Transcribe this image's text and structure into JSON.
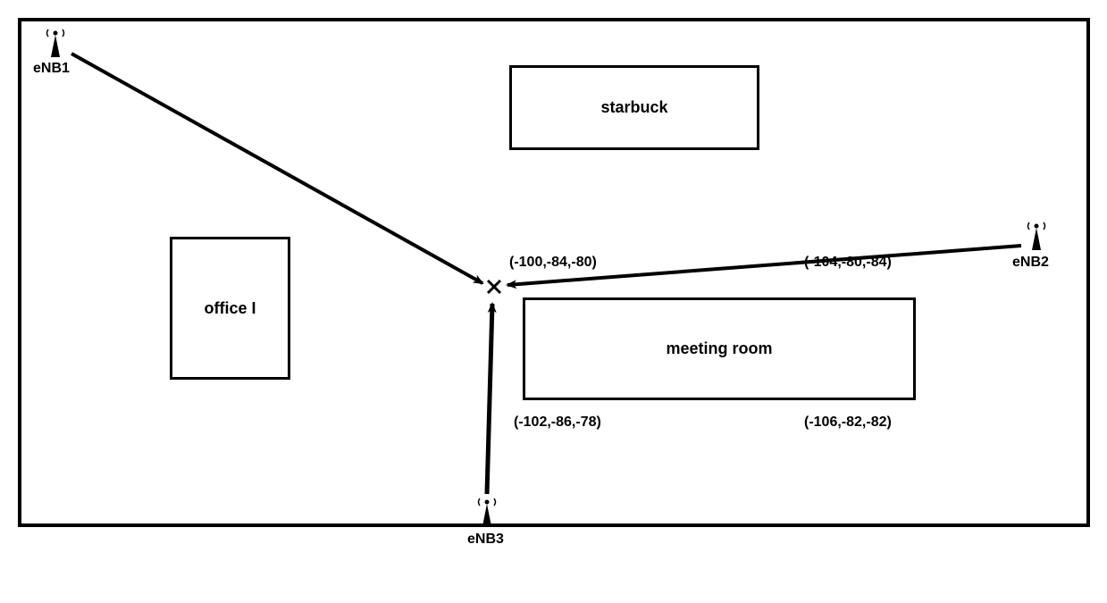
{
  "rooms": {
    "starbuck": {
      "label": "starbuck"
    },
    "office1": {
      "label": "office I"
    },
    "meeting": {
      "label": "meeting room"
    }
  },
  "enbs": {
    "enb1": {
      "label": "eNB1"
    },
    "enb2": {
      "label": "eNB2"
    },
    "enb3": {
      "label": "eNB3"
    }
  },
  "coords": {
    "c1": "(-100,-84,-80)",
    "c2": "(-104,-80,-84)",
    "c3": "(-102,-86,-78)",
    "c4": "(-106,-82,-82)"
  }
}
